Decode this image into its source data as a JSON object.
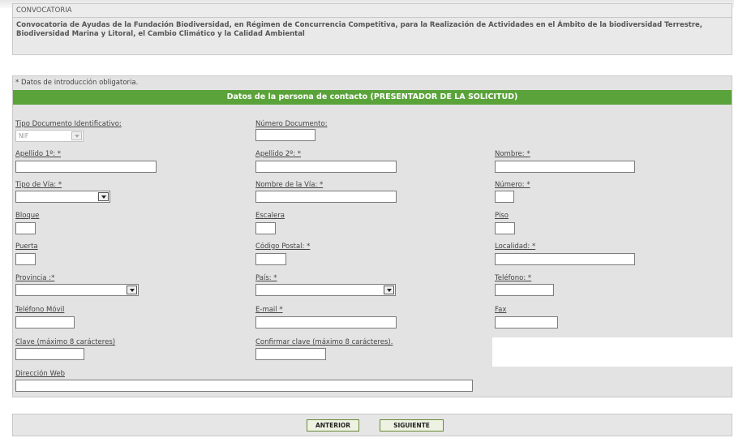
{
  "convocatoria": {
    "header": "CONVOCATORIA",
    "text": "Convocatoria de Ayudas de la Fundación Biodiversidad, en Régimen de Concurrencia Competitiva, para la Realización de Actividades en el Ámbito de la biodiversidad Terrestre, Biodiversidad Marina y Litoral, el Cambio Climático y la Calidad Ambiental"
  },
  "form": {
    "required_note": "* Datos de introducción obligatoria.",
    "section_title": "Datos de la persona de contacto (PRESENTADOR DE LA SOLICITUD)",
    "fields": {
      "tipo_documento": {
        "label": "Tipo Documento Identificativo:",
        "value": "NIF"
      },
      "numero_documento": {
        "label": "Número Documento:"
      },
      "apellido1": {
        "label": "Apellido 1º: *"
      },
      "apellido2": {
        "label": "Apellido 2º: *"
      },
      "nombre": {
        "label": "Nombre: *"
      },
      "tipo_via": {
        "label": "Tipo de Vía: *"
      },
      "nombre_via": {
        "label": "Nombre de la Vía: *"
      },
      "numero": {
        "label": "Número: *"
      },
      "bloque": {
        "label": "Bloque"
      },
      "escalera": {
        "label": "Escalera"
      },
      "piso": {
        "label": "Piso"
      },
      "puerta": {
        "label": "Puerta"
      },
      "codigo_postal": {
        "label": "Código Postal: *"
      },
      "localidad": {
        "label": "Localidad: *"
      },
      "provincia": {
        "label": "Provincia :*"
      },
      "pais": {
        "label": "País: *"
      },
      "telefono": {
        "label": "Teléfono: *"
      },
      "telefono_movil": {
        "label": "Teléfono Móvil"
      },
      "email": {
        "label": "E-mail *"
      },
      "fax": {
        "label": "Fax"
      },
      "clave": {
        "label": "Clave (máximo 8 carácteres)"
      },
      "confirmar_clave": {
        "label": "Confirmar clave (máximo 8 carácteres)."
      },
      "direccion_web": {
        "label": "Dirección Web"
      }
    }
  },
  "buttons": {
    "anterior": "ANTERIOR",
    "siguiente": "SIGUIENTE"
  }
}
